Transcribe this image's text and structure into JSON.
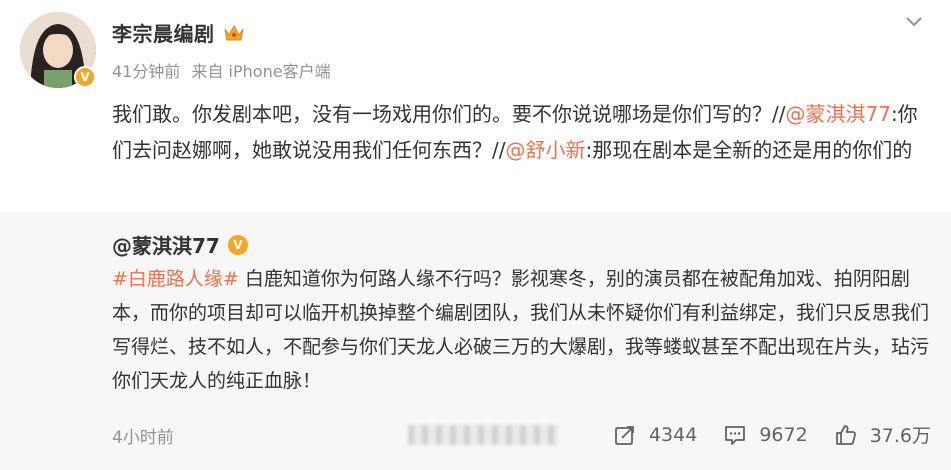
{
  "author": {
    "name": "李宗晨编剧",
    "time": "41分钟前",
    "source": "来自 iPhone客户端"
  },
  "post": {
    "seg1": "我们敢。你发剧本吧，没有一场戏用你们的。要不你说说哪场是你们写的？//",
    "mention1": "@蒙淇淇77",
    "seg2": ":你们去问赵娜啊，她敢说没用我们任何东西？//",
    "mention2": "@舒小新",
    "seg3": ":那现在剧本是全新的还是用的你们的"
  },
  "repost": {
    "author": "@蒙淇淇77",
    "hashtag": "#白鹿路人缘#",
    "text": " 白鹿知道你为何路人缘不行吗？影视寒冬，别的演员都在被配角加戏、拍阴阳剧本，而你的项目却可以临开机换掉整个编剧团队，我们从未怀疑你们有利益绑定，我们只反思我们写得烂、技不如人，不配参与你们天龙人必破三万的大爆剧，我等蝼蚁甚至不配出现在片头，玷污你们天龙人的纯正血脉！",
    "time": "4小时前",
    "reposts": "4344",
    "comments": "9672",
    "likes": "37.6万"
  },
  "icons": {
    "more": "chevron-down-icon",
    "repost": "share-icon",
    "comment": "comment-icon",
    "like": "thumbs-up-icon",
    "crown": "crown-icon"
  },
  "colors": {
    "link": "#eb7350",
    "meta": "#939393",
    "gold": "#f5a623",
    "repost_bg": "#f7f7f7"
  }
}
